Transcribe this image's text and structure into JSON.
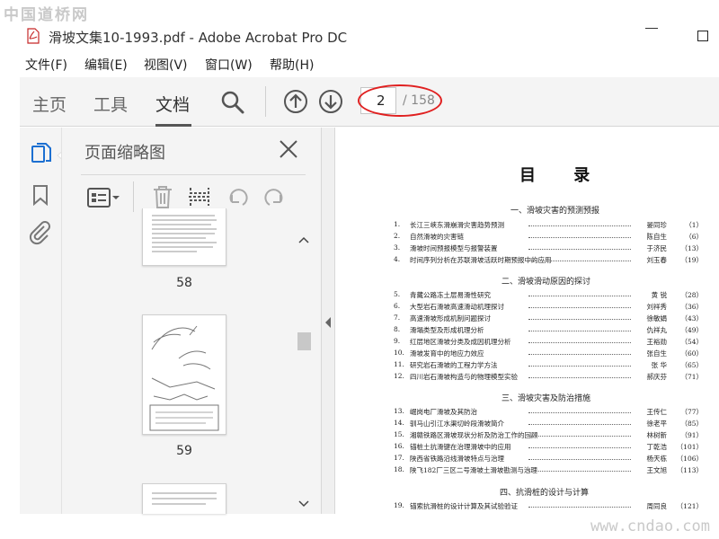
{
  "watermark_top": "中国道桥网",
  "watermark_bottom": "www.cndao.com",
  "window": {
    "title": "滑坡文集10-1993.pdf - Adobe Acrobat Pro DC"
  },
  "menu": [
    "文件(F)",
    "编辑(E)",
    "视图(V)",
    "窗口(W)",
    "帮助(H)"
  ],
  "toolbar": {
    "tabs": [
      "主页",
      "工具",
      "文档"
    ],
    "active_tab": "文档",
    "page_current": "2",
    "page_total": "/ 158"
  },
  "side_panel": {
    "title": "页面缩略图",
    "thumbnails": [
      {
        "page": "58"
      },
      {
        "page": "59"
      }
    ]
  },
  "document": {
    "heading": "目 录",
    "sections": [
      {
        "title": "一、滑坡灾害的预测预报",
        "entries": [
          {
            "n": "1.",
            "t": "长江三峡东滑崩滑灾害趋势预测",
            "a": "晏同珍",
            "p": "（1）"
          },
          {
            "n": "2.",
            "t": "自然滑坡的灾害链",
            "a": "陈自生",
            "p": "（6）"
          },
          {
            "n": "3.",
            "t": "滑坡时间预报模型与报警装置",
            "a": "于济民",
            "p": "（13）"
          },
          {
            "n": "4.",
            "t": "时间序列分析在苏联滑坡活跃时期预报中的应用",
            "a": "刘玉春",
            "p": "（19）"
          }
        ]
      },
      {
        "title": "二、滑坡滑动原因的探讨",
        "entries": [
          {
            "n": "5.",
            "t": "青藏公路冻土层易滑性研究",
            "a": "黄 锐",
            "p": "（28）"
          },
          {
            "n": "6.",
            "t": "大型岩石滑坡高速滑动机理探讨",
            "a": "刘祥秀",
            "p": "（36）"
          },
          {
            "n": "7.",
            "t": "高速滑坡形成机制问题探讨",
            "a": "徐敏娟",
            "p": "（43）"
          },
          {
            "n": "8.",
            "t": "滑塌类型及形成机理分析",
            "a": "仇祥丸",
            "p": "（49）"
          },
          {
            "n": "9.",
            "t": "红层地区滑坡分类及成因机理分析",
            "a": "王裕勋",
            "p": "（54）"
          },
          {
            "n": "10.",
            "t": "滑坡发育中的地应力效应",
            "a": "张自生",
            "p": "（60）"
          },
          {
            "n": "11.",
            "t": "研究岩石滑坡的工程力学方法",
            "a": "张 华",
            "p": "（65）"
          },
          {
            "n": "12.",
            "t": "四川岩石滑坡构造与的物理模型实验",
            "a": "郝庆芬",
            "p": "（71）"
          }
        ]
      },
      {
        "title": "三、滑坡灾害及防治措施",
        "entries": [
          {
            "n": "13.",
            "t": "崛岗电厂滑坡及其防治",
            "a": "王传仁",
            "p": "（77）"
          },
          {
            "n": "14.",
            "t": "驯马山引江水渠切岭段滑坡简介",
            "a": "徐老平",
            "p": "（85）"
          },
          {
            "n": "15.",
            "t": "湘赣铁路区滑坡现状分析及防治工作的回顾",
            "a": "林树新",
            "p": "（91）"
          },
          {
            "n": "16.",
            "t": "锚桩土抗滑键在治理滑坡中的应用",
            "a": "丁乾浩",
            "p": "（101）"
          },
          {
            "n": "17.",
            "t": "陕西省铁路沿线滑坡特点与治理",
            "a": "杨天栋",
            "p": "（106）"
          },
          {
            "n": "18.",
            "t": "陕飞182厂三区二号滑坡土滑坡勘测与治理",
            "a": "王文旭",
            "p": "（113）"
          }
        ]
      },
      {
        "title": "四、抗滑桩的设计与计算",
        "entries": [
          {
            "n": "19.",
            "t": "锚索抗滑桩的设计计算及其试验验证",
            "a": "周同良",
            "p": "（121）"
          }
        ]
      }
    ]
  },
  "colors": {
    "toolbar_bg": "#f4f4f4",
    "highlight_oval": "#e02020",
    "icon_blue": "#1c6fd1"
  }
}
